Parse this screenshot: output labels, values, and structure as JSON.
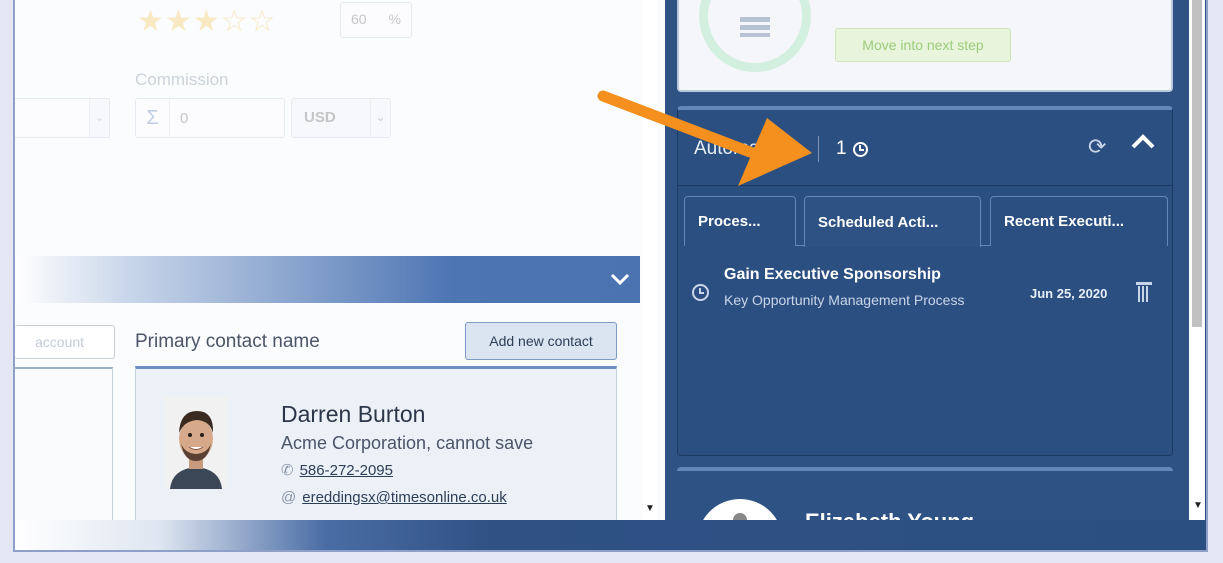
{
  "left_panel": {
    "rating_percent": "60",
    "percent_symbol": "%",
    "commission_label": "Commission",
    "commission_value": "0",
    "sigma_glyph": "Σ",
    "currency": "USD",
    "account_button": "account",
    "primary_contact_label": "Primary contact name",
    "add_contact_button": "Add new contact",
    "contact": {
      "name": "Darren Burton",
      "company": "Acme Corporation, cannot save",
      "phone": "586-272-2095",
      "email": "ereddingsx@timesonline.co.uk",
      "at_glyph": "@",
      "phone_glyph": "✆"
    }
  },
  "right_panel": {
    "next_step_button": "Move into next step",
    "automatizer": {
      "title": "Automatizer",
      "count": "1",
      "tabs": [
        "Proces...",
        "Scheduled Acti...",
        "Recent Executi..."
      ],
      "scheduled_action": {
        "title": "Gain Executive Sponsorship",
        "subtitle": "Key Opportunity Management Process",
        "date": "Jun 25, 2020"
      }
    },
    "next_card_name": "Elizabeth Young"
  },
  "colors": {
    "panel_blue": "#2c4f82",
    "accent_blue": "#4b73b0",
    "arrow_orange": "#f5901e",
    "star_gold": "#f2c24a"
  },
  "icons": [
    "star-icon",
    "sigma-icon",
    "chevron-down-icon",
    "clock-icon",
    "refresh-icon",
    "chevron-up-icon",
    "trash-icon",
    "phone-icon",
    "at-icon"
  ]
}
